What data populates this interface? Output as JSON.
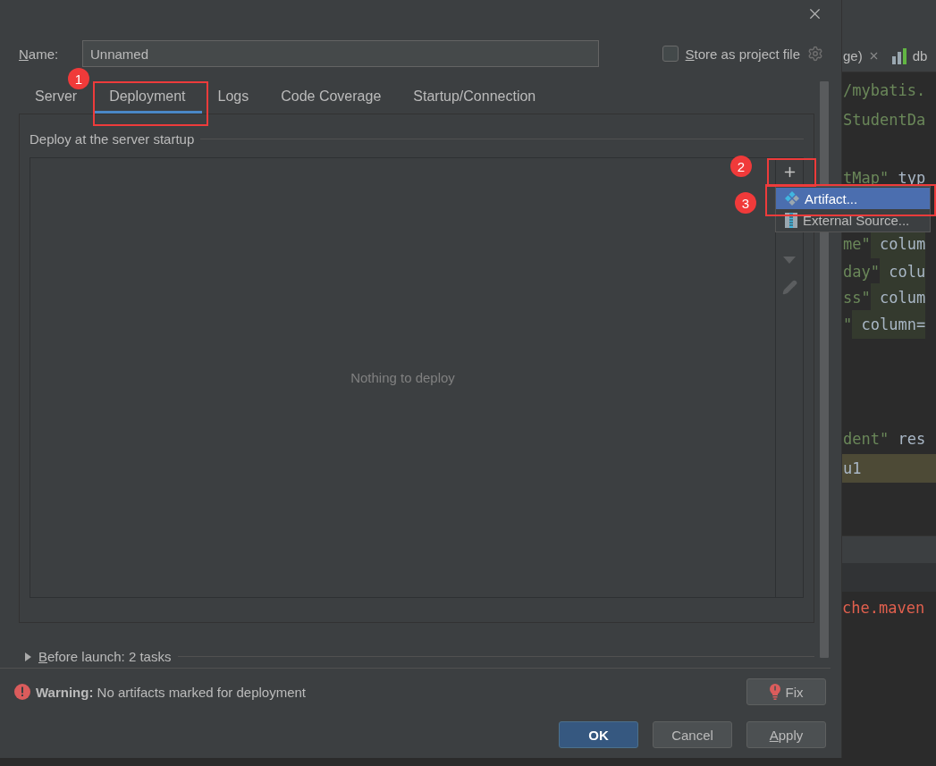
{
  "dialog": {
    "name_label": "Name:",
    "name_value": "Unnamed",
    "store_as_project_file": {
      "label": "Store as project file",
      "checked": false
    },
    "tabs": [
      {
        "label": "Server",
        "selected": false
      },
      {
        "label": "Deployment",
        "selected": true
      },
      {
        "label": "Logs",
        "selected": false
      },
      {
        "label": "Code Coverage",
        "selected": false
      },
      {
        "label": "Startup/Connection",
        "selected": false
      }
    ],
    "section_title": "Deploy at the server startup",
    "empty_text": "Nothing to deploy",
    "add_menu": [
      {
        "label": "Artifact...",
        "selected": true,
        "kind": "artifact"
      },
      {
        "label": "External Source...",
        "selected": false,
        "kind": "external"
      }
    ],
    "before_launch": {
      "label": "Before launch: 2 tasks",
      "expanded": false
    },
    "warning": "**Warning:** No artifacts marked for deployment",
    "fix_button": "Fix",
    "buttons": [
      {
        "label": "OK",
        "kind": "primary"
      },
      {
        "label": "Cancel",
        "kind": "normal"
      },
      {
        "label": "Apply",
        "kind": "normal"
      }
    ]
  },
  "annotations": [
    {
      "number": "1"
    },
    {
      "number": "2"
    },
    {
      "number": "3"
    }
  ],
  "editor": {
    "tabs": [
      {
        "label": "ge)",
        "kind": "closable"
      },
      {
        "label": "db",
        "kind": "db"
      }
    ],
    "lines": [
      {
        "segments": [
          {
            "text": "/mybatis.",
            "kind": "str"
          }
        ]
      },
      {
        "segments": [
          {
            "text": "StudentDa",
            "kind": "str"
          }
        ]
      },
      {
        "segments": [
          {
            "text": "tMap\"",
            "kind": "str"
          },
          {
            "text": " typ",
            "kind": "plain"
          }
        ]
      },
      {
        "segments": [
          {
            "text": "me\"",
            "kind": "str"
          },
          {
            "text": " colum",
            "kind": "match"
          }
        ]
      },
      {
        "segments": [
          {
            "text": "day\"",
            "kind": "str"
          },
          {
            "text": " colu",
            "kind": "match"
          }
        ]
      },
      {
        "segments": [
          {
            "text": "ss\"",
            "kind": "str"
          },
          {
            "text": " colum",
            "kind": "match"
          }
        ]
      },
      {
        "segments": [
          {
            "text": "\"",
            "kind": "str"
          },
          {
            "text": " column=",
            "kind": "match"
          }
        ]
      },
      {
        "segments": [
          {
            "text": "dent\"",
            "kind": "str"
          },
          {
            "text": " res",
            "kind": "plain"
          }
        ]
      },
      {
        "segments": [
          {
            "text": "u1",
            "kind": "current"
          }
        ]
      }
    ],
    "console_line": "che.maven"
  }
}
